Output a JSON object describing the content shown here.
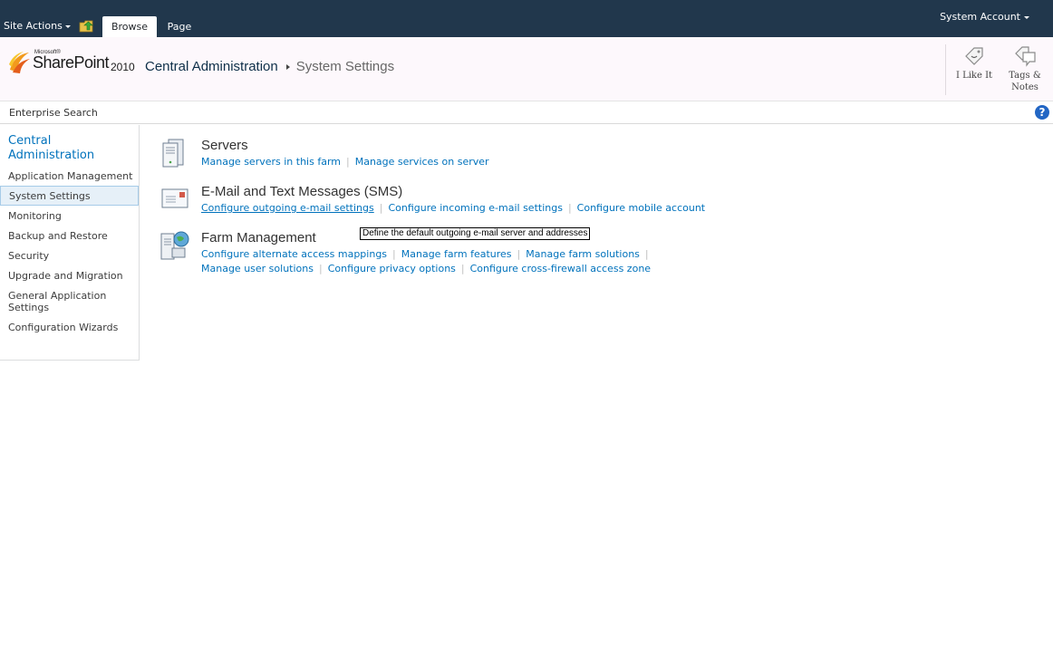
{
  "ribbon": {
    "site_actions": "Site Actions",
    "tabs": [
      {
        "label": "Browse",
        "selected": true
      },
      {
        "label": "Page",
        "selected": false
      }
    ],
    "account": "System Account"
  },
  "logo": {
    "company": "Microsoft®",
    "product": "SharePoint",
    "version": "2010"
  },
  "breadcrumb": {
    "root": "Central Administration",
    "current": "System Settings"
  },
  "social": {
    "i_like_it": "I Like It",
    "tags_line1": "Tags &",
    "tags_line2": "Notes"
  },
  "search": {
    "label": "Enterprise Search",
    "help_icon": "?"
  },
  "leftnav": {
    "header_line1": "Central",
    "header_line2": "Administration",
    "items": [
      {
        "label": "Application Management"
      },
      {
        "label": "System Settings",
        "selected": true
      },
      {
        "label": "Monitoring"
      },
      {
        "label": "Backup and Restore"
      },
      {
        "label": "Security"
      },
      {
        "label": "Upgrade and Migration"
      },
      {
        "label": "General Application",
        "label2": "Settings"
      },
      {
        "label": "Configuration Wizards"
      }
    ]
  },
  "sections": {
    "servers": {
      "title": "Servers",
      "links": [
        "Manage servers in this farm",
        "Manage services on server"
      ]
    },
    "email": {
      "title": "E-Mail and Text Messages (SMS)",
      "links": [
        "Configure outgoing e-mail settings",
        "Configure incoming e-mail settings",
        "Configure mobile account"
      ]
    },
    "farm": {
      "title": "Farm Management",
      "links_row1": [
        "Configure alternate access mappings",
        "Manage farm features",
        "Manage farm solutions"
      ],
      "links_row2": [
        "Manage user solutions",
        "Configure privacy options",
        "Configure cross-firewall access zone"
      ]
    }
  },
  "tooltip": "Define the default outgoing e-mail server and addresses",
  "colors": {
    "ribbon_bg": "#21374c",
    "link": "#0072bc",
    "title_bg": "#fdf8fc"
  }
}
